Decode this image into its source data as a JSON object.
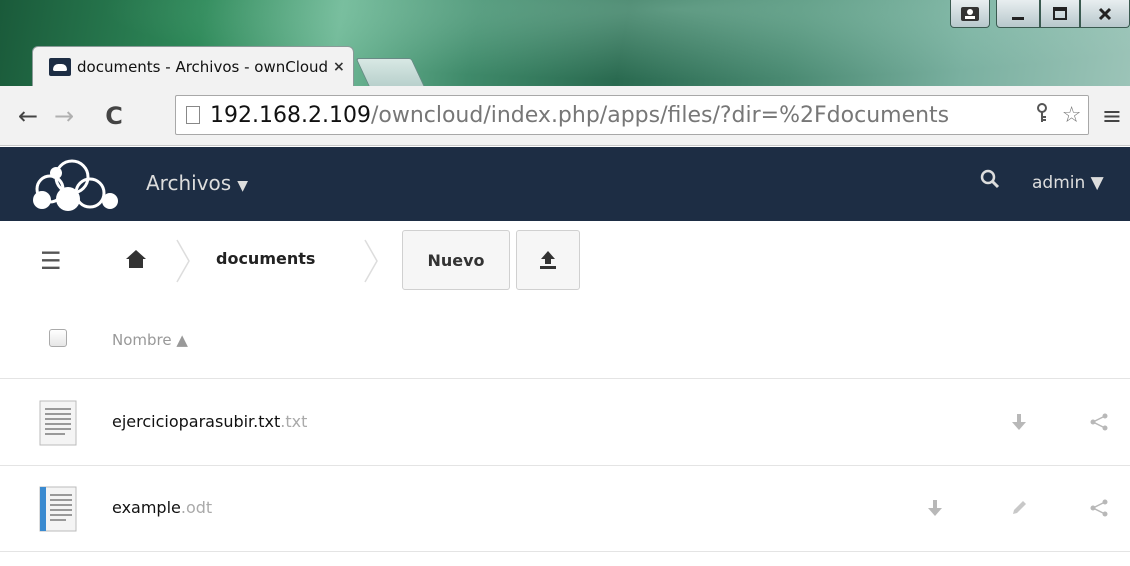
{
  "browser": {
    "tab_title": "documents - Archivos - ownCloud",
    "tab_close": "×",
    "url_host": "192.168.2.109",
    "url_path": "/owncloud/index.php/apps/files/?dir=%2Fdocuments"
  },
  "header": {
    "app_name": "Archivos",
    "app_caret": "▼",
    "user": "admin ▼"
  },
  "controls": {
    "breadcrumb": "documents",
    "new_button": "Nuevo"
  },
  "list": {
    "column_name": "Nombre ▲",
    "files": [
      {
        "base": "ejercicioparasubir.txt",
        "ext": ".txt",
        "type": "text"
      },
      {
        "base": "example",
        "ext": ".odt",
        "type": "odt"
      }
    ]
  },
  "colors": {
    "header_bg": "#1d2d44",
    "icon_gray": "#b8b8b8"
  }
}
